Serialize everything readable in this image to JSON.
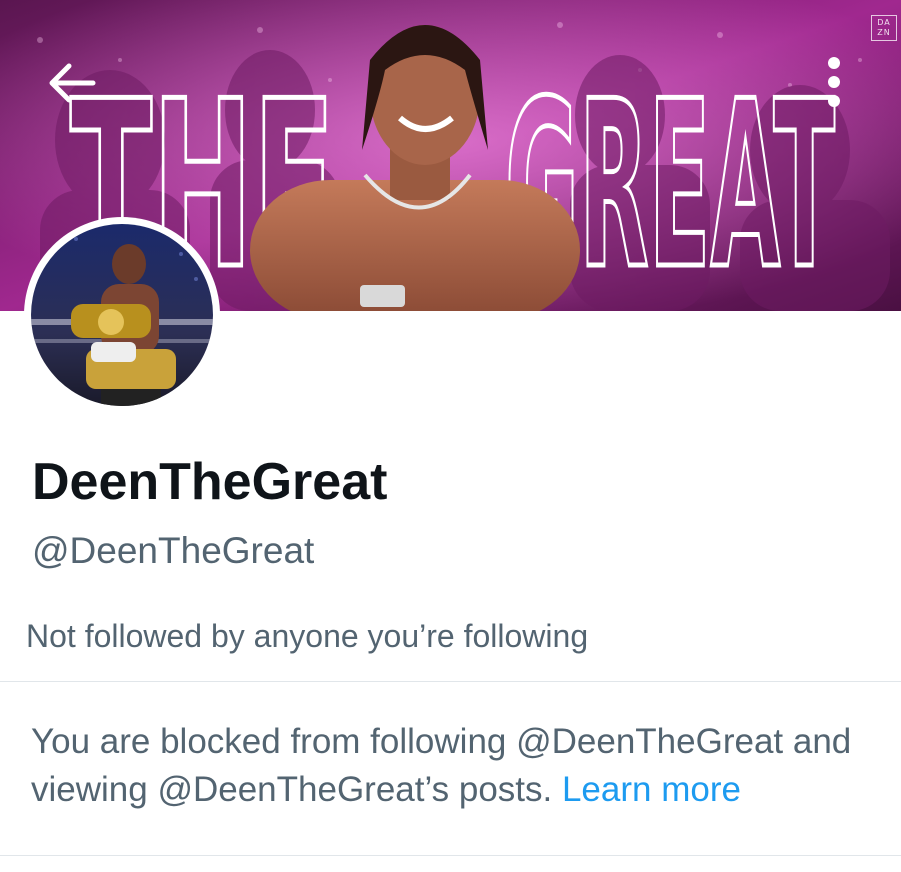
{
  "banner": {
    "overlay_text": "THE GREAT",
    "badge_text": "DA ZN",
    "back_icon": "arrow-left-icon",
    "more_icon": "more-vertical-icon",
    "colors": {
      "magenta": "#d43ac2",
      "dark": "#2a0a24"
    }
  },
  "profile": {
    "display_name": "DeenTheGreat",
    "handle": "@DeenTheGreat",
    "followers_note": "Not followed by anyone you’re following"
  },
  "blocked": {
    "message": "You are blocked from following @DeenTheGreat and viewing @DeenTheGreat’s posts.",
    "learn_more_label": "Learn more",
    "link_color": "#1d9bf0"
  }
}
